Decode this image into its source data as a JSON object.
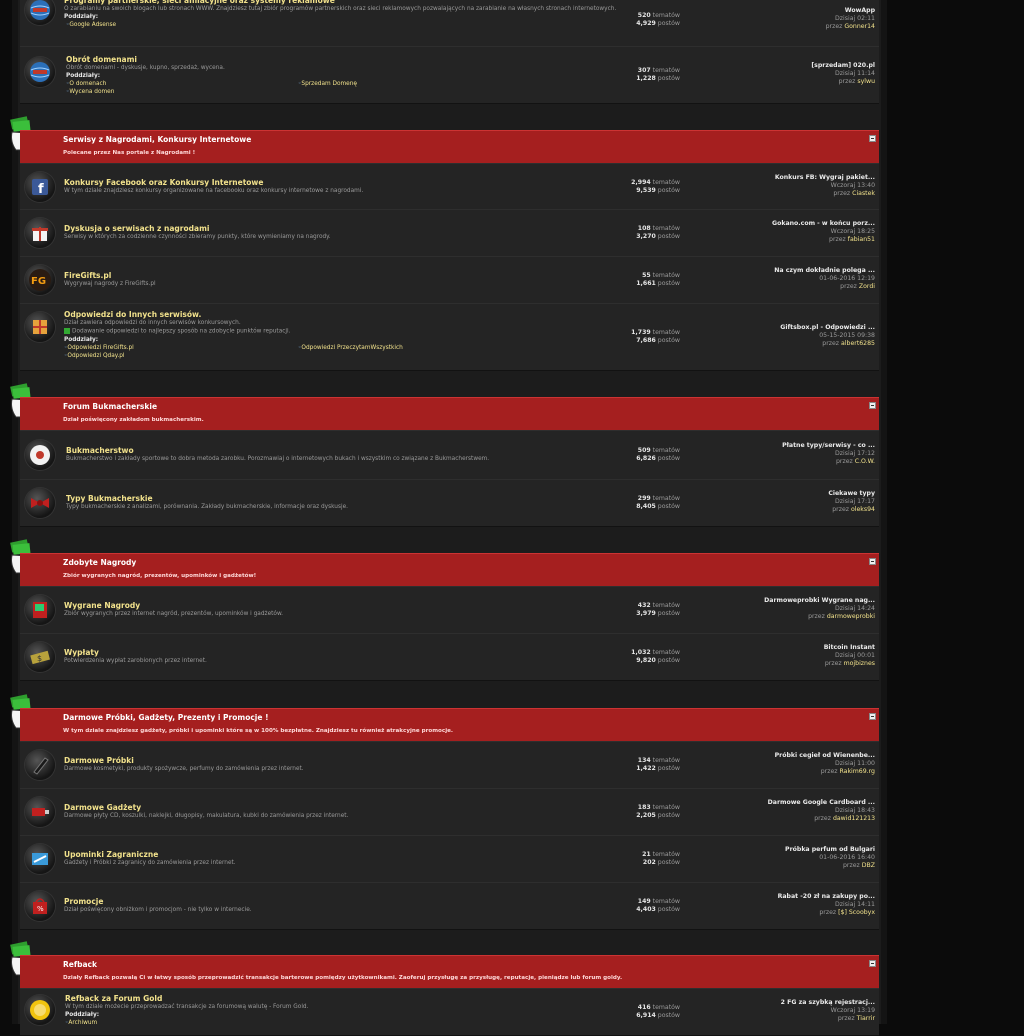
{
  "stats_labels": {
    "topics": "tematów",
    "posts": "postów",
    "by": "przez"
  },
  "colors": {
    "category_bar": "#a51f1f",
    "forum_title": "#f2e28c",
    "row_bg": "#242424",
    "page_bg": "#0b0b0b"
  },
  "top_forums": [
    {
      "icon": "globe-icon",
      "title": "Programy partnerskie, sieci afiliacyjne oraz systemy reklamowe",
      "desc": "O zarabianiu na swoich blogach lub stronach WWW. Znajdziesz tutaj zbiór programów partnerskich oraz sieci reklamowych pozwalających na zarabianie na własnych stronach internetowych.",
      "subforums_label": "Poddziały:",
      "subforums": [
        "Google Adsense"
      ],
      "topics": "520",
      "posts": "4,929",
      "last_title": "WowApp",
      "last_time": "Dzisiaj 02:11",
      "last_user": "Gonner14"
    },
    {
      "icon": "globe-icon",
      "title": "Obrót domenami",
      "desc": "Obrót domenami - dyskusje, kupno, sprzedaż, wycena.",
      "subforums_label": "Poddziały:",
      "subforums": [
        "O domenach",
        "Sprzedam Domenę",
        "Wycena domen"
      ],
      "topics": "307",
      "posts": "1,228",
      "last_title": "[sprzedam] 020.pl",
      "last_time": "Dzisiaj 11:14",
      "last_user": "sylwu"
    }
  ],
  "categories": [
    {
      "title": "Serwisy z Nagrodami, Konkursy Internetowe",
      "desc": "Polecane przez Nas portale z Nagrodami !",
      "forums": [
        {
          "icon": "facebook-icon",
          "title": "Konkursy Facebook oraz Konkursy Internetowe",
          "desc": "W tym dziale znajdziesz konkursy organizowane na facebooku oraz konkursy internetowe z nagrodami.",
          "topics": "2,994",
          "posts": "9,539",
          "last_title": "Konkurs FB: Wygraj pakiet...",
          "last_time": "Wczoraj 13:40",
          "last_user": "Ciastek"
        },
        {
          "icon": "gift-icon",
          "title": "Dyskusja o serwisach z nagrodami",
          "desc": "Serwisy w których za codzienne czynności zbieramy punkty, które wymieniamy na nagrody.",
          "topics": "108",
          "posts": "3,270",
          "last_title": "Gokano.com - w końcu porz...",
          "last_time": "Wczoraj 18:25",
          "last_user": "fabian51"
        },
        {
          "icon": "firegifts-icon",
          "title": "FireGifts.pl",
          "desc": "Wygrywaj nagrody z FireGifts.pl",
          "topics": "55",
          "posts": "1,661",
          "last_title": "Na czym dokładnie polega ...",
          "last_time": "01-06-2016 12:19",
          "last_user": "Zordi"
        },
        {
          "icon": "box-icon",
          "title": "Odpowiedzi do Innych serwisów.",
          "desc": "Dział zawiera odpowiedzi do innych serwisów konkursowych.",
          "desc2": "Dodawanie odpowiedzi to najlepszy sposób na zdobycie punktów reputacji.",
          "subforums_label": "Poddziały:",
          "subforums": [
            "Odpowiedzi FireGifts.pl",
            "Odpowiedzi PrzeczytamWszystkich",
            "Odpowiedzi Qday.pl"
          ],
          "topics": "1,739",
          "posts": "7,686",
          "last_title": "Giftsbox.pl - Odpowiedzi ...",
          "last_time": "05-15-2015 09:38",
          "last_user": "albert6285"
        }
      ]
    },
    {
      "title": "Forum Bukmacherskie",
      "desc": "Dział poświęcony zakładom bukmacherskim.",
      "forums": [
        {
          "icon": "ball-icon",
          "title": "Bukmacherstwo",
          "desc": "Bukmacherstwo i zakłady sportowe to dobra metoda zarobku. Porozmawiaj o internetowych bukach i wszystkim co związane z Bukmacherstwem.",
          "topics": "509",
          "posts": "6,826",
          "last_title": "Płatne typy/serwisy - co ...",
          "last_time": "Dzisiaj 17:12",
          "last_user": "C.O.W."
        },
        {
          "icon": "ribbon-icon",
          "title": "Typy Bukmacherskie",
          "desc": "Typy bukmacherskie z analizami, porównania. Zakłady bukmacherskie, informacje oraz dyskusje.",
          "topics": "299",
          "posts": "8,405",
          "last_title": "Ciekawe typy",
          "last_time": "Dzisiaj 17:17",
          "last_user": "oleks94"
        }
      ]
    },
    {
      "title": "Zdobyte Nagrody",
      "desc": "Zbiór wygranych nagród, prezentów, upominków i gadżetów!",
      "forums": [
        {
          "icon": "book-icon",
          "title": "Wygrane Nagrody",
          "desc": "Zbiór wygranych przez internet nagród, prezentów, upominków i gadżetów.",
          "topics": "432",
          "posts": "3,979",
          "last_title": "Darmoweprobki Wygrane nag...",
          "last_time": "Dzisiaj 14:24",
          "last_user": "darmoweprobki"
        },
        {
          "icon": "money-icon",
          "title": "Wypłaty",
          "desc": "Potwierdzenia wypłat zarobionych przez internet.",
          "topics": "1,032",
          "posts": "9,820",
          "last_title": "Bitcoin Instant",
          "last_time": "Dzisiaj 00:01",
          "last_user": "mojbiznes"
        }
      ]
    },
    {
      "title": "Darmowe Próbki, Gadżety, Prezenty i Promocje !",
      "desc": "W tym dziale znajdziesz gadżety, próbki i upominki które są w 100% bezpłatne. Znajdziesz tu również atrakcyjne promocje.",
      "forums": [
        {
          "icon": "pen-icon",
          "title": "Darmowe Próbki",
          "desc": "Darmowe kosmetyki, produkty spożywcze, perfumy do zamówienia przez internet.",
          "topics": "134",
          "posts": "1,422",
          "last_title": "Próbki cegieł od Wienenbe...",
          "last_time": "Dzisiaj 11:00",
          "last_user": "Rakim69.rg"
        },
        {
          "icon": "usb-icon",
          "title": "Darmowe Gadżety",
          "desc": "Darmowe płyty CD, koszulki, naklejki, długopisy, makulatura, kubki do zamówienia przez internet.",
          "topics": "183",
          "posts": "2,205",
          "last_title": "Darmowe Google Cardboard ...",
          "last_time": "Dzisiaj 18:43",
          "last_user": "dawid121213"
        },
        {
          "icon": "plane-icon",
          "title": "Upominki Zagraniczne",
          "desc": "Gadżety i Próbki z zagranicy do zamówienia przez internet.",
          "topics": "21",
          "posts": "202",
          "last_title": "Próbka perfum od Bulgari",
          "last_time": "01-06-2016 16:40",
          "last_user": "DBZ"
        },
        {
          "icon": "shopping-bag-icon",
          "title": "Promocje",
          "desc": "Dział poświęcony obniżkom i promocjom - nie tylko w internecie.",
          "topics": "149",
          "posts": "4,403",
          "last_title": "Rabat -20 zł na zakupy po...",
          "last_time": "Dzisiaj 14:11",
          "last_user": "[$] Scoobyx"
        }
      ]
    },
    {
      "title": "Refback",
      "desc": "Działy Refback pozwalą Ci w łatwy sposób przeprowadzić transakcje barterowe pomiędzy użytkownikami. Zaoferuj przysługę za przysługę, reputacje, pieniądze lub forum goldy.",
      "forums": [
        {
          "icon": "coin-icon",
          "title": "Refback za Forum Gold",
          "desc": "W tym dziale możecie przeprowadzać transakcje za forumową walutę - Forum Gold.",
          "subforums_label": "Poddziały:",
          "subforums": [
            "Archiwum"
          ],
          "topics": "416",
          "posts": "6,914",
          "last_title": "2 FG za szybką rejestracj...",
          "last_time": "Wczoraj 13:19",
          "last_user": "Tiarrir"
        }
      ]
    }
  ]
}
